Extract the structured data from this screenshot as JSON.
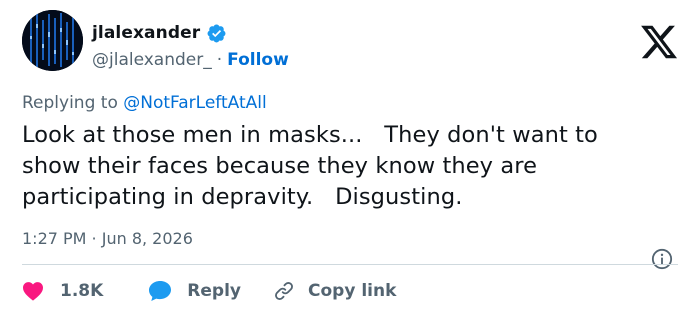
{
  "user": {
    "display_name": "jlalexander",
    "handle": "@jlalexander_",
    "separator": "·",
    "follow_label": "Follow"
  },
  "reply": {
    "prefix": "Replying to ",
    "mention": "@NotFarLeftAtAll"
  },
  "tweet": {
    "lines": [
      "Look at those men in masks...   They don't want to",
      "show their faces because they know they are",
      "participating in depravity.   Disgusting."
    ],
    "timestamp": "1:27 PM · Jun 8, 2026"
  },
  "actions": {
    "like_count": "1.8K",
    "reply_label": "Reply",
    "copy_label": "Copy link"
  },
  "colors": {
    "link": "#006fd6",
    "muted": "#536471",
    "text": "#0f1419",
    "like": "#f91880",
    "reply": "#1d9bf0",
    "verified": "#1d9bf0"
  },
  "icons": {
    "brand": "x-logo-icon",
    "verified": "verified-badge-icon",
    "info": "info-icon",
    "like": "heart-icon",
    "reply": "speech-bubble-icon",
    "copy": "link-icon"
  }
}
